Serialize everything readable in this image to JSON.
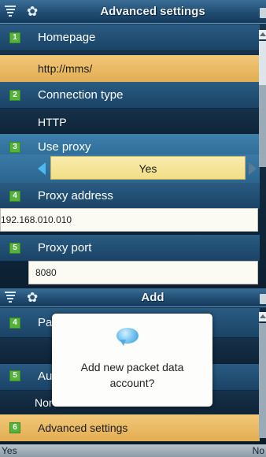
{
  "top_screen": {
    "title": "Advanced settings",
    "rows": [
      {
        "number": "1",
        "label": "Homepage",
        "value": "http://mms/"
      },
      {
        "number": "2",
        "label": "Connection type",
        "value": "HTTP"
      },
      {
        "number": "3",
        "label": "Use proxy",
        "value": "Yes"
      },
      {
        "number": "4",
        "label": "Proxy address",
        "value": "192.168.010.010"
      },
      {
        "number": "5",
        "label": "Proxy port",
        "value": "8080"
      }
    ]
  },
  "bottom_screen": {
    "title": "Add",
    "rows": [
      {
        "number": "4",
        "label": "Pas"
      },
      {
        "number": "5",
        "label": "Aut",
        "value": "Nor"
      },
      {
        "number": "6",
        "label": "Advanced settings"
      }
    ],
    "dialog": {
      "line1": "Add new packet data",
      "line2": "account?"
    },
    "softkeys": {
      "left": "Yes",
      "right": "No"
    }
  },
  "icons": [
    "signal-icon",
    "gear-icon",
    "chat-bubble-icon",
    "scroll-up-icon"
  ],
  "colors": {
    "header_blue": "#2a5b82",
    "highlight_orange": "#e3ad52",
    "picker_yellow": "#f2de86",
    "badge_green": "#55b33b",
    "arrow_blue": "#4db9f0"
  }
}
